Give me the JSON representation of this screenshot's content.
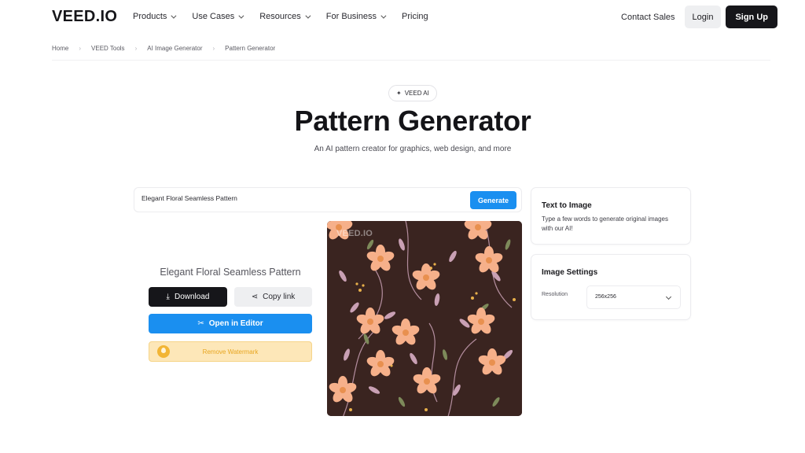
{
  "nav": {
    "logo": "VEED.IO",
    "menu": [
      {
        "label": "Products",
        "has_dropdown": true
      },
      {
        "label": "Use Cases",
        "has_dropdown": true
      },
      {
        "label": "Resources",
        "has_dropdown": true
      },
      {
        "label": "For Business",
        "has_dropdown": true
      },
      {
        "label": "Pricing",
        "has_dropdown": false
      }
    ],
    "contact_sales": "Contact Sales",
    "login": "Login",
    "signup": "Sign Up"
  },
  "breadcrumb": [
    "Home",
    "VEED Tools",
    "AI Image Generator",
    "Pattern Generator"
  ],
  "hero": {
    "badge": "VEED AI",
    "title": "Pattern Generator",
    "subtitle": "An AI pattern creator for graphics, web design, and more"
  },
  "prompt": {
    "value": "Elegant Floral Seamless Pattern",
    "generate_label": "Generate"
  },
  "result": {
    "title": "Elegant Floral Seamless Pattern",
    "download_label": "Download",
    "copy_label": "Copy link",
    "editor_label": "Open in Editor",
    "watermark_label": "Remove Watermark",
    "image_watermark": "VEED.IO"
  },
  "panels": {
    "text_to_image": {
      "title": "Text to Image",
      "text": "Type a few words to generate original images with our AI!"
    },
    "image_settings": {
      "title": "Image Settings",
      "resolution_label": "Resolution",
      "resolution_value": "256x256"
    }
  },
  "colors": {
    "accent_blue": "#1a8ff0",
    "dark": "#16161a",
    "pattern_background": "#3a2420",
    "flower_peach": "#f6b08a",
    "leaf_mauve": "#c9a0b4",
    "leaf_green": "#7d8a5a",
    "watermark_yellow": "#fde7b8"
  }
}
